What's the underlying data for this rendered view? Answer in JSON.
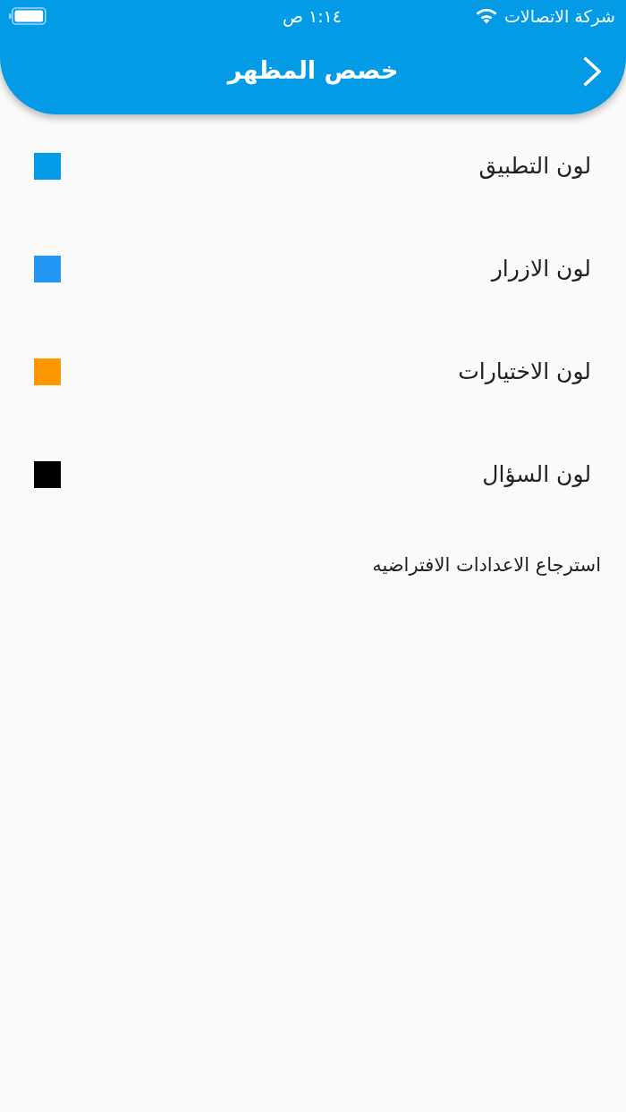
{
  "status_bar": {
    "carrier": "شركة الاتصالات",
    "time": "١:١٤ ص"
  },
  "header": {
    "title": "خصص المظهر"
  },
  "color_options": [
    {
      "label": "لون التطبيق",
      "color": "#039be5"
    },
    {
      "label": "لون الازرار",
      "color": "#2196f3"
    },
    {
      "label": "لون الاختيارات",
      "color": "#ff9800"
    },
    {
      "label": "لون السؤال",
      "color": "#000000"
    }
  ],
  "reset_button": {
    "label": "استرجاع الاعدادات الافتراضيه"
  }
}
